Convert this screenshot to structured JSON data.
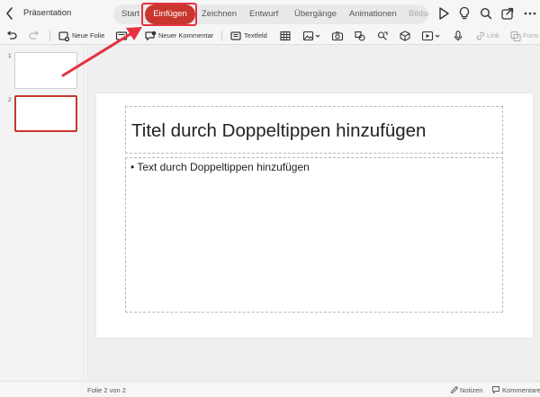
{
  "app": {
    "title": "Präsentation"
  },
  "tabs": [
    {
      "label": "Start",
      "active": false
    },
    {
      "label": "Einfügen",
      "active": true
    },
    {
      "label": "Zeichnen",
      "active": false
    },
    {
      "label": "Entwurf",
      "active": false
    },
    {
      "label": "Übergänge",
      "active": false
    },
    {
      "label": "Animationen",
      "active": false
    },
    {
      "label": "Bildsc",
      "active": false
    }
  ],
  "ribbon": {
    "new_slide": "Neue Folie",
    "new_comment": "Neuer Kommentar",
    "textbox": "Textfeld",
    "link": "Link",
    "forms": "Form"
  },
  "thumbnails": [
    {
      "number": "1",
      "selected": false
    },
    {
      "number": "2",
      "selected": true
    }
  ],
  "slide": {
    "title_placeholder": "Titel durch Doppeltippen hinzufügen",
    "body_placeholder": "• Text durch Doppeltippen hinzufügen"
  },
  "status": {
    "slide_counter": "Folie 2 von 2",
    "notes": "Notizen",
    "comments": "Kommentare"
  },
  "colors": {
    "accent": "#c8362d",
    "annotation": "#e53242"
  }
}
